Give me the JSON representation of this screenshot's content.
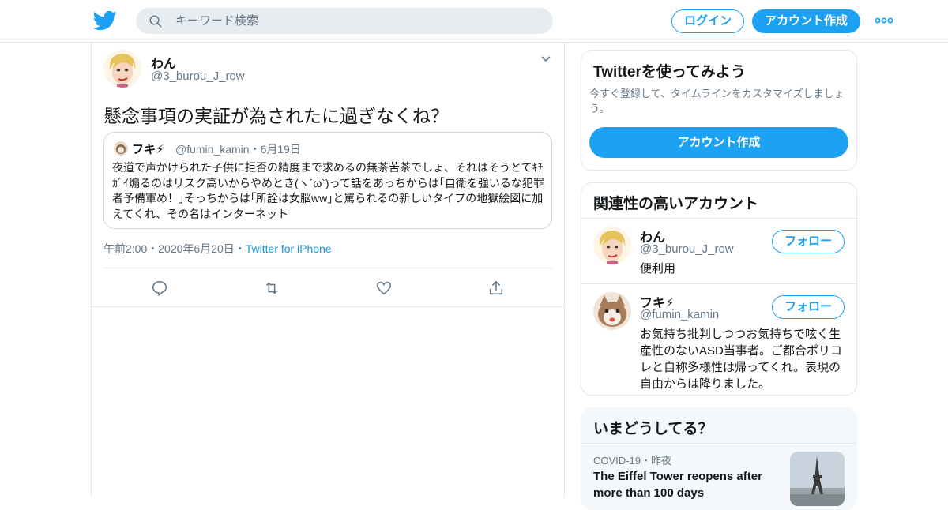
{
  "header": {
    "search_placeholder": "キーワード検索",
    "login_label": "ログイン",
    "signup_label": "アカウント作成",
    "accent": "#1da1f2"
  },
  "tweet": {
    "author_name": "わん",
    "author_handle": "@3_burou_J_row",
    "text": "懸念事項の実証が為されたに過ぎなくね？",
    "quote": {
      "name": "フキ⚡",
      "handle": "@fumin_kamin",
      "date": "6月19日",
      "body": "夜道で声かけられた子供に拒否の精度まで求めるの無茶苦茶でしょ、それはそうとてｷﾁｶﾞｲ煽るのはリスク高いからやめとき(ヽ´ω`)って話をあっちからは｢自衛を強いるな犯罪者予備軍め！｣そっちからは｢所詮は女脳ww｣と罵られるの新しいタイプの地獄絵図に加えてくれ、その名はインターネット"
    },
    "time": "午前2:00",
    "date": "2020年6月20日",
    "source": "Twitter for iPhone",
    "actions": [
      "reply-icon",
      "retweet-icon",
      "like-icon",
      "share-icon"
    ]
  },
  "sidebar": {
    "try": {
      "title": "Twitterを使ってみよう",
      "description": "今すぐ登録して、タイムラインをカスタマイズしましょう。",
      "button": "アカウント作成"
    },
    "related": {
      "title": "関連性の高いアカウント",
      "follow_label": "フォロー",
      "accounts": [
        {
          "name": "わん",
          "handle": "@3_burou_J_row",
          "bio": "便利用"
        },
        {
          "name": "フキ⚡",
          "handle": "@fumin_kamin",
          "bio": "お気持ち批判しつつお気持ちで呟く生産性のないASD当事者。ご都合ポリコレと自称多様性は帰ってくれ。表現の自由からは降りました。"
        }
      ]
    },
    "trends": {
      "title": "いまどうしてる？",
      "items": [
        {
          "meta": "COVID-19・昨夜",
          "title": "The Eiffel Tower reopens after more than 100 days"
        }
      ]
    }
  }
}
